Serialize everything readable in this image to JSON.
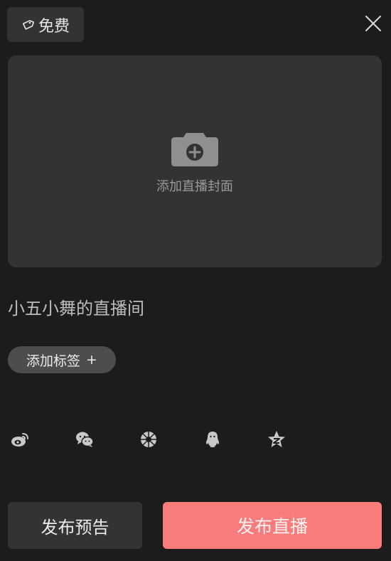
{
  "header": {
    "price_label": "免费",
    "price_icon": "tag-icon",
    "close_icon": "close-icon"
  },
  "cover": {
    "label": "添加直播封面",
    "icon": "camera-add-icon"
  },
  "room": {
    "title": "小五小舞的直播间"
  },
  "tags": {
    "add_label": "添加标签",
    "add_symbol": "+"
  },
  "share": {
    "targets": [
      "weibo-icon",
      "wechat-icon",
      "moments-icon",
      "qq-icon",
      "qzone-icon"
    ]
  },
  "footer": {
    "preview_label": "发布预告",
    "publish_label": "发布直播"
  },
  "colors": {
    "background": "#1c1c1c",
    "card": "#333333",
    "accent": "#f97c7c"
  }
}
